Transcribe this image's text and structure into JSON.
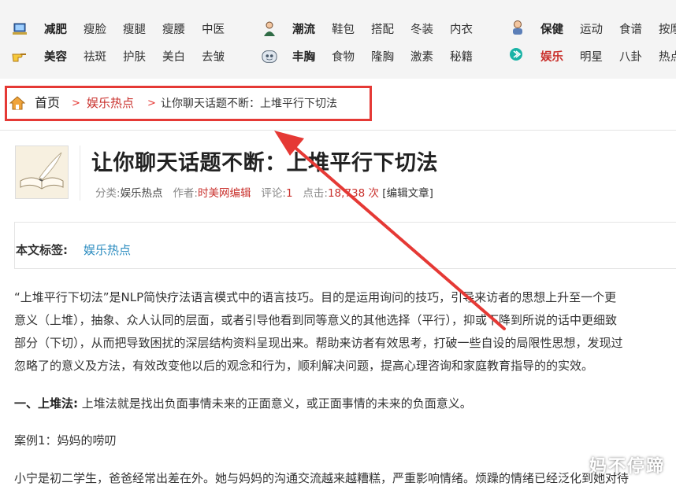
{
  "nav": {
    "groups": [
      {
        "icon": "laptop-icon",
        "row1": [
          "减肥",
          "瘦脸",
          "瘦腿",
          "瘦腰",
          "中医"
        ],
        "row2_icon": "pointing-hand-icon",
        "row2": [
          "美容",
          "祛斑",
          "护肤",
          "美白",
          "去皱"
        ]
      },
      {
        "icon": "person-icon",
        "row1": [
          "潮流",
          "鞋包",
          "搭配",
          "冬装",
          "内衣"
        ],
        "row2_icon": "face-icon",
        "row2": [
          "丰胸",
          "食物",
          "隆胸",
          "激素",
          "秘籍"
        ]
      },
      {
        "icon": "doctor-icon",
        "row1": [
          "保健",
          "运动",
          "食谱",
          "按摩"
        ],
        "row2_icon": "arrow-circle-icon",
        "row2": [
          "娱乐",
          "明星",
          "八卦",
          "热点"
        ]
      }
    ]
  },
  "breadcrumb": {
    "home": "首页",
    "sep": ">",
    "category": "娱乐热点",
    "current": "让你聊天话题不断：上堆平行下切法"
  },
  "article": {
    "title": "让你聊天话题不断：上堆平行下切法",
    "meta": {
      "category_label": "分类:",
      "category": "娱乐热点",
      "author_label": "作者:",
      "author": "时美网编辑",
      "comments_label": "评论:",
      "comments": "1",
      "views_label": "点击:",
      "views": "18,738 次",
      "edit_link": "[编辑文章]"
    },
    "tags_label": "本文标签:",
    "tags": "娱乐热点",
    "paragraphs": [
      "“上堆平行下切法”是NLP简快疗法语言模式中的语言技巧。目的是运用询问的技巧，引导来访者的思想上升至一个更",
      "意义（上堆），抽象、众人认同的层面，或者引导他看到同等意义的其他选择（平行），抑或下降到所说的话中更细致",
      "部分（下切），从而把导致困扰的深层结构资料呈现出来。帮助来访者有效思考，打破一些自设的局限性思想，发现过",
      "忽略了的意义及方法，有效改变他以后的观念和行为，顺利解决问题，提高心理咨询和家庭教育指导的的实效。"
    ],
    "section1_heading": "一、上堆法:",
    "section1_text": " 上堆法就是找出负面事情未来的正面意义，或正面事情的未来的负面意义。",
    "case_label": "案例1：妈妈的唠叨",
    "case_text": "小宁是初二学生，爸爸经常出差在外。她与妈妈的沟通交流越来越糟糕，严重影响情绪。烦躁的情绪已经泛化到她对待"
  },
  "watermark": "妈不停蹄",
  "colors": {
    "accent_red": "#c9302c",
    "annotation_red": "#e53935",
    "tag_blue": "#2a8bbf"
  }
}
